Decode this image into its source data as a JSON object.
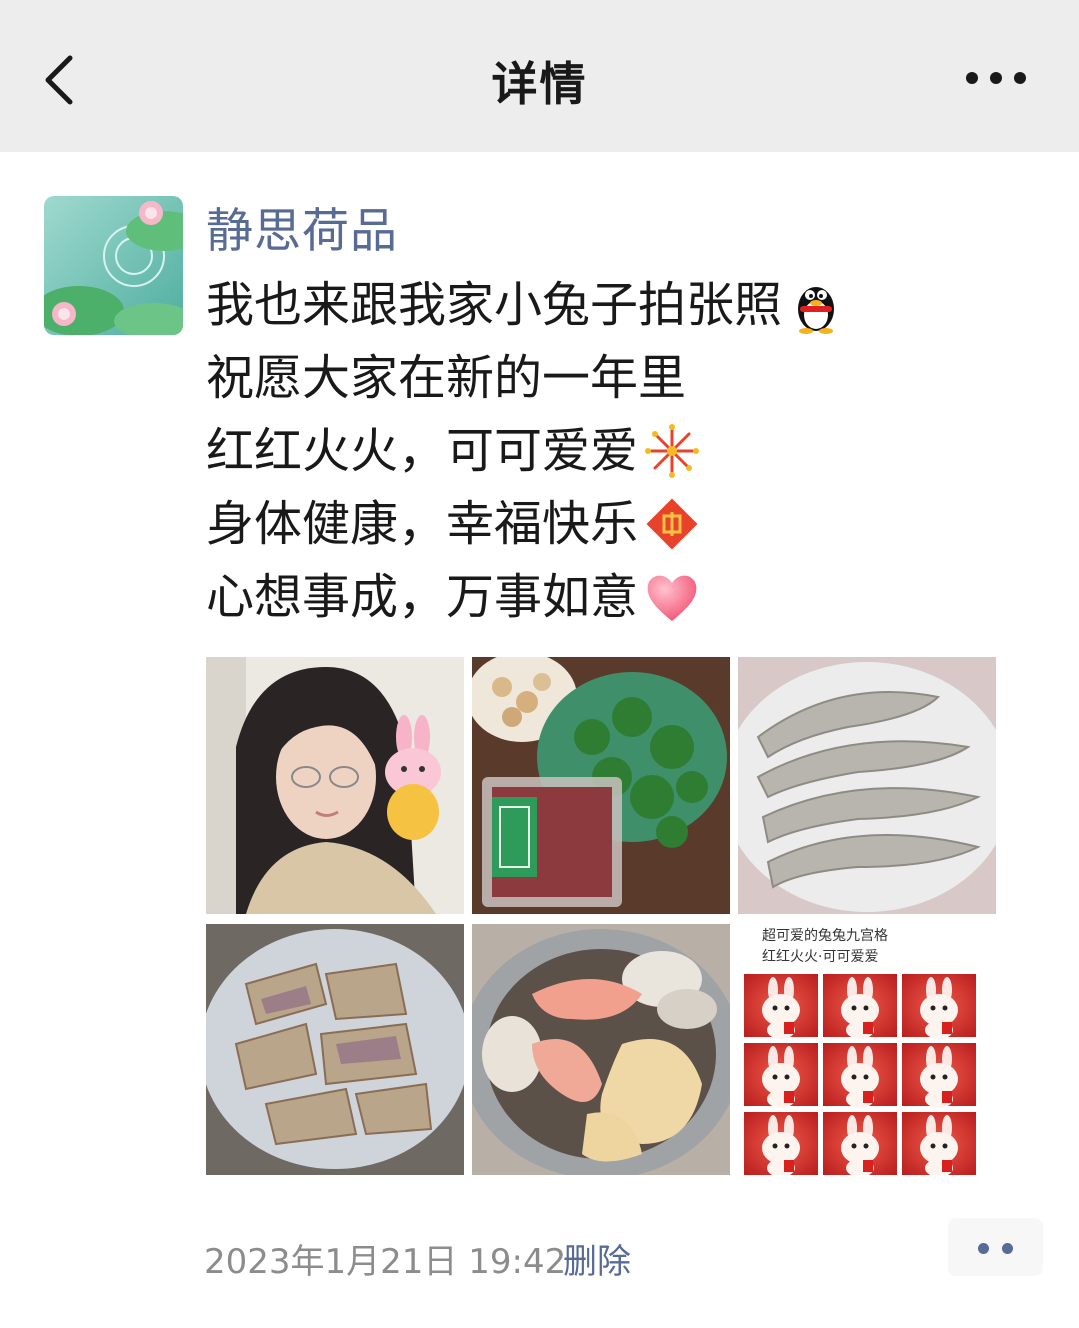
{
  "nav": {
    "title": "详情",
    "back_icon": "chevron-left-icon",
    "more_icon": "more-dots-icon"
  },
  "post": {
    "author": "静思荷品",
    "lines": [
      {
        "text": "我也来跟我家小兔子拍张照",
        "emoji": "penguin-emoji"
      },
      {
        "text": "祝愿大家在新的一年里",
        "emoji": ""
      },
      {
        "text": "红红火火，可可爱爱",
        "emoji": "fireworks-emoji"
      },
      {
        "text": "身体健康，幸福快乐",
        "emoji": "fu-emoji"
      },
      {
        "text": "心想事成，万事如意",
        "emoji": "heart-emoji"
      }
    ],
    "photos": [
      {
        "name": "photo-selfie-with-rabbit"
      },
      {
        "name": "photo-greens-and-beef"
      },
      {
        "name": "photo-raw-shrimp"
      },
      {
        "name": "photo-sliced-duck"
      },
      {
        "name": "photo-seafood-bowl"
      },
      {
        "name": "photo-rabbit-grid",
        "caption_line1": "超可爱的兔兔九宫格",
        "caption_line2": "红红火火·可可爱爱"
      }
    ],
    "timestamp": "2023年1月21日 19:42",
    "delete_label": "删除",
    "action_icon": "comment-action-icon"
  },
  "colors": {
    "navbar_bg": "#ededed",
    "link_blue": "#576b95",
    "text_main": "#191919",
    "text_meta": "#8c8c8c"
  }
}
